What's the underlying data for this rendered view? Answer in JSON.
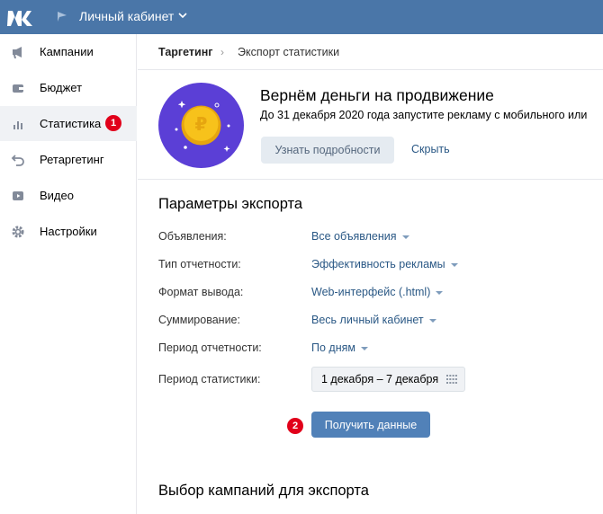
{
  "header": {
    "title": "Личный кабинет",
    "logo": "vk-logo",
    "colors": {
      "bar": "#4a76a8"
    }
  },
  "sidebar": {
    "items": [
      {
        "label": "Кампании",
        "icon": "megaphone-icon"
      },
      {
        "label": "Бюджет",
        "icon": "wallet-icon"
      },
      {
        "label": "Статистика",
        "icon": "bar-chart-icon",
        "active": true,
        "badge": "1"
      },
      {
        "label": "Ретаргетинг",
        "icon": "return-arrow-icon"
      },
      {
        "label": "Видео",
        "icon": "play-icon"
      },
      {
        "label": "Настройки",
        "icon": "gear-icon"
      }
    ]
  },
  "breadcrumb": {
    "first": "Таргетинг",
    "separator": "›",
    "second": "Экспорт статистики"
  },
  "promo": {
    "title": "Вернём деньги на продвижение",
    "subtitle": "До 31 декабря 2020 года запустите рекламу с мобильного или",
    "more_button": "Узнать подробности",
    "hide_button": "Скрыть",
    "coin_symbol": "₽"
  },
  "export": {
    "title": "Параметры экспорта",
    "params": [
      {
        "label": "Объявления:",
        "value": "Все объявления"
      },
      {
        "label": "Тип отчетности:",
        "value": "Эффективность рекламы"
      },
      {
        "label": "Формат вывода:",
        "value": "Web-интерфейс (.html)"
      },
      {
        "label": "Суммирование:",
        "value": "Весь личный кабинет"
      },
      {
        "label": "Период отчетности:",
        "value": "По дням"
      }
    ],
    "period_label": "Период статистики:",
    "period_value": "1 декабря – 7 декабря",
    "submit_button": "Получить данные",
    "submit_badge": "2"
  },
  "campaigns": {
    "title": "Выбор кампаний для экспорта"
  },
  "colors": {
    "accent": "#4a76a8",
    "link": "#2a5885",
    "primary_button": "#5181b8",
    "badge": "#e1001a",
    "promo_circle": "#5b3fd6",
    "coin": "#f7c21b"
  }
}
